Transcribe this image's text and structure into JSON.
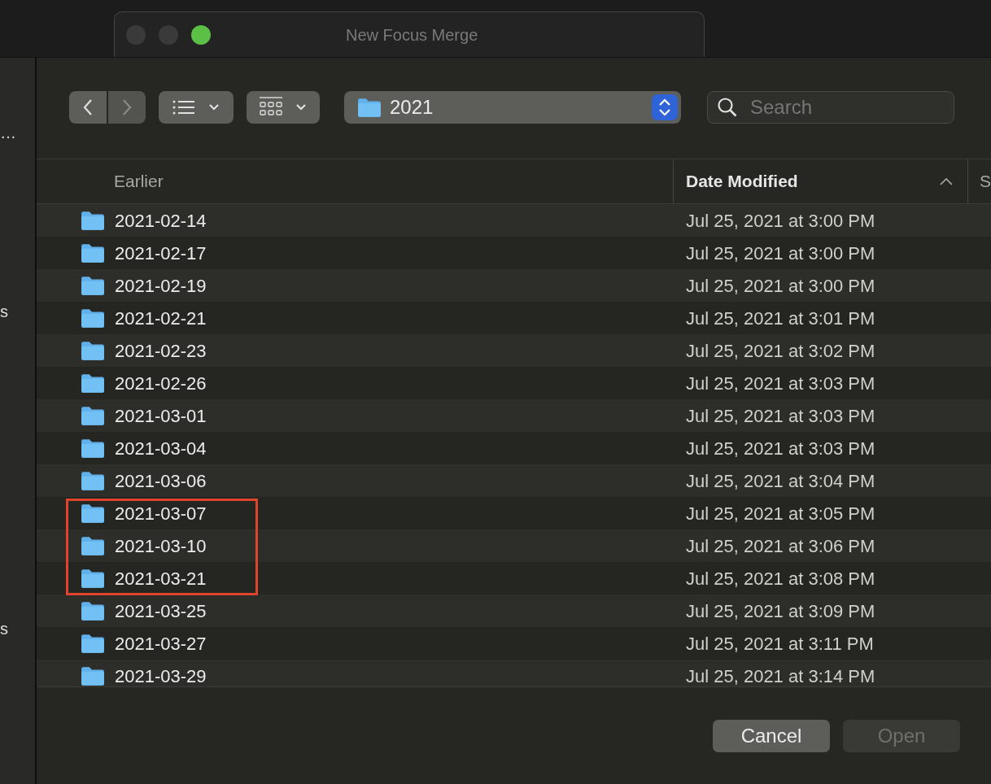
{
  "background_window": {
    "title": "New Focus Merge",
    "traffic_lights": [
      {
        "color": "#3a3a3a"
      },
      {
        "color": "#3a3a3a"
      },
      {
        "color": "#5ac146"
      }
    ]
  },
  "sidebar": {
    "fragments": [
      "…",
      "s",
      "s"
    ]
  },
  "toolbar": {
    "location": "2021",
    "search": {
      "placeholder": "Search"
    }
  },
  "table": {
    "columns": [
      {
        "label": "Earlier",
        "bold": false,
        "sorted": false
      },
      {
        "label": "Date Modified",
        "bold": true,
        "sorted": true
      },
      {
        "label": "S",
        "bold": false,
        "sorted": false
      }
    ],
    "rows": [
      {
        "name": "2021-02-14",
        "date": "Jul 25, 2021 at 3:00 PM",
        "highlighted": false
      },
      {
        "name": "2021-02-17",
        "date": "Jul 25, 2021 at 3:00 PM",
        "highlighted": false
      },
      {
        "name": "2021-02-19",
        "date": "Jul 25, 2021 at 3:00 PM",
        "highlighted": false
      },
      {
        "name": "2021-02-21",
        "date": "Jul 25, 2021 at 3:01 PM",
        "highlighted": false
      },
      {
        "name": "2021-02-23",
        "date": "Jul 25, 2021 at 3:02 PM",
        "highlighted": false
      },
      {
        "name": "2021-02-26",
        "date": "Jul 25, 2021 at 3:03 PM",
        "highlighted": false
      },
      {
        "name": "2021-03-01",
        "date": "Jul 25, 2021 at 3:03 PM",
        "highlighted": false
      },
      {
        "name": "2021-03-04",
        "date": "Jul 25, 2021 at 3:03 PM",
        "highlighted": false
      },
      {
        "name": "2021-03-06",
        "date": "Jul 25, 2021 at 3:04 PM",
        "highlighted": false
      },
      {
        "name": "2021-03-07",
        "date": "Jul 25, 2021 at 3:05 PM",
        "highlighted": true
      },
      {
        "name": "2021-03-10",
        "date": "Jul 25, 2021 at 3:06 PM",
        "highlighted": true
      },
      {
        "name": "2021-03-21",
        "date": "Jul 25, 2021 at 3:08 PM",
        "highlighted": true
      },
      {
        "name": "2021-03-25",
        "date": "Jul 25, 2021 at 3:09 PM",
        "highlighted": false
      },
      {
        "name": "2021-03-27",
        "date": "Jul 25, 2021 at 3:11 PM",
        "highlighted": false
      },
      {
        "name": "2021-03-29",
        "date": "Jul 25, 2021 at 3:14 PM",
        "highlighted": false
      }
    ]
  },
  "buttons": [
    {
      "label": "Cancel",
      "disabled": false
    },
    {
      "label": "Open",
      "disabled": true
    }
  ]
}
